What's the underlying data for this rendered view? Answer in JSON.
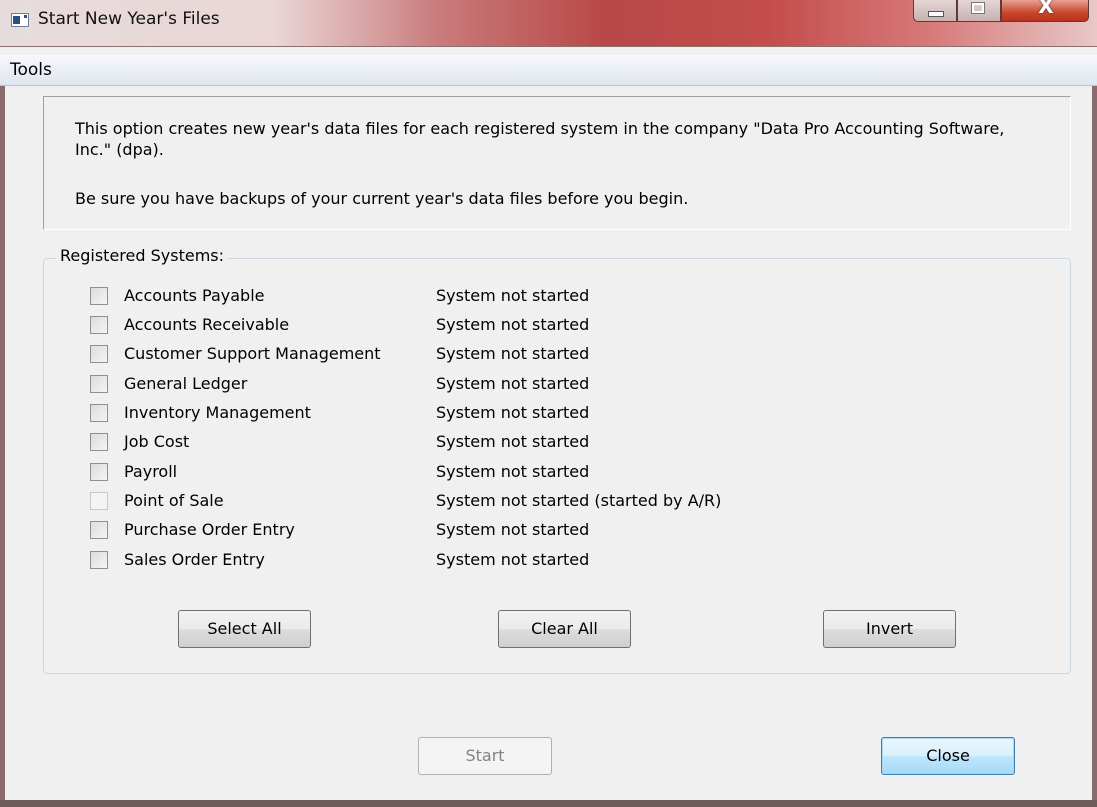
{
  "window": {
    "title": "Start New Year's Files",
    "close_glyph": "X"
  },
  "menu": {
    "tools": "Tools"
  },
  "info": {
    "line1": "This option creates new year's data files for each registered system in the company \"Data Pro Accounting Software, Inc.\" (dpa).",
    "line2": "Be sure you have backups of your current year's data files before you begin."
  },
  "registered": {
    "label": "Registered Systems:",
    "systems": [
      {
        "name": "Accounts Payable",
        "status": "System not started",
        "checked": false,
        "enabled": true
      },
      {
        "name": "Accounts Receivable",
        "status": "System not started",
        "checked": false,
        "enabled": true
      },
      {
        "name": "Customer Support Management",
        "status": "System not started",
        "checked": false,
        "enabled": true
      },
      {
        "name": "General Ledger",
        "status": "System not started",
        "checked": false,
        "enabled": true
      },
      {
        "name": "Inventory Management",
        "status": "System not started",
        "checked": false,
        "enabled": true
      },
      {
        "name": "Job Cost",
        "status": "System not started",
        "checked": false,
        "enabled": true
      },
      {
        "name": "Payroll",
        "status": "System not started",
        "checked": false,
        "enabled": true
      },
      {
        "name": "Point of Sale",
        "status": "System not started (started by A/R)",
        "checked": false,
        "enabled": false
      },
      {
        "name": "Purchase Order Entry",
        "status": "System not started",
        "checked": false,
        "enabled": true
      },
      {
        "name": "Sales Order Entry",
        "status": "System not started",
        "checked": false,
        "enabled": true
      }
    ]
  },
  "buttons": {
    "select_all": "Select All",
    "clear_all": "Clear All",
    "invert": "Invert",
    "start": "Start",
    "close": "Close"
  }
}
